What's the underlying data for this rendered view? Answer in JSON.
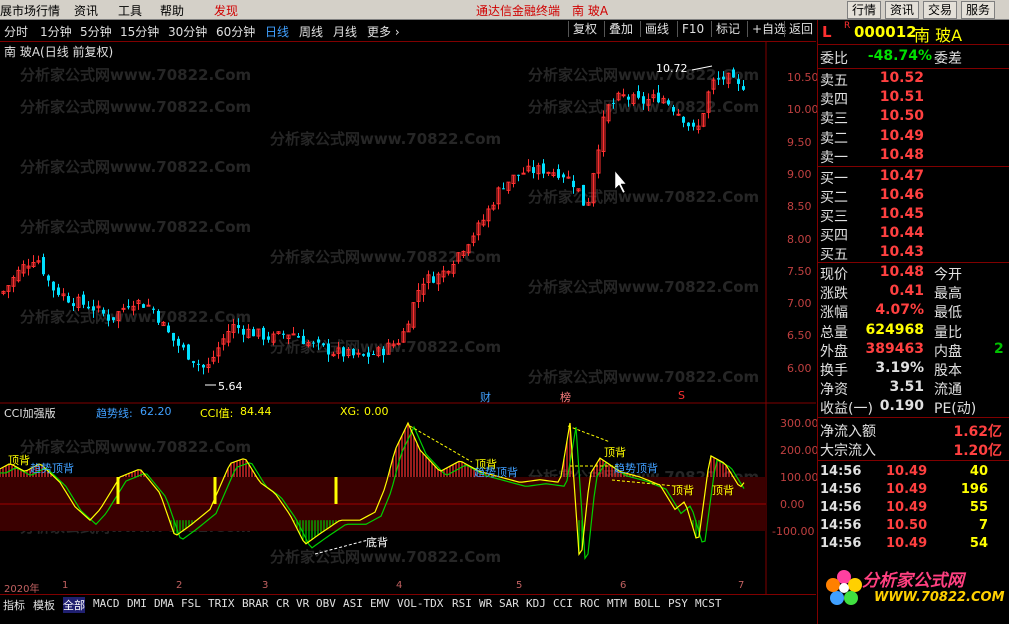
{
  "menu": {
    "items": [
      "展市场行情",
      "资讯",
      "工具",
      "帮助",
      "发现"
    ],
    "center_title": "通达信金融终端",
    "stock_title": "南 玻A",
    "right_buttons": [
      "行情",
      "资讯",
      "交易",
      "服务"
    ]
  },
  "timeframes": [
    "分时",
    "1分钟",
    "5分钟",
    "15分钟",
    "30分钟",
    "60分钟",
    "日线",
    "周线",
    "月线",
    "更多 ›"
  ],
  "active_timeframe": "日线",
  "toolbar_buttons": [
    "复权",
    "叠加",
    "画线",
    "F10",
    "标记",
    "+自选",
    "返回"
  ],
  "chart_title": "南 玻A(日线 前复权)",
  "watermark": "分析家公式网www.70822.Com",
  "price_axis": [
    "10.50",
    "10.00",
    "9.50",
    "9.00",
    "8.50",
    "8.00",
    "7.50",
    "7.00",
    "6.50",
    "6.00"
  ],
  "annotations": {
    "high": "10.72",
    "low": "5.64",
    "cai": "财",
    "mark": "榜",
    "s": "S"
  },
  "indicator": {
    "name": "CCI加强版",
    "trend_label": "趋势线:",
    "trend_value": "62.20",
    "cci_label": "CCI值:",
    "cci_value": "84.44",
    "xg_label": "XG:",
    "xg_value": "0.00",
    "axis": [
      "300.00",
      "200.00",
      "100.00",
      "0.00",
      "-100.00"
    ],
    "labels": [
      "顶背",
      "趋势顶背",
      "顶背",
      "趋势顶背",
      "顶背",
      "趋势顶背",
      "顶背",
      "顶背",
      "底背"
    ]
  },
  "date_axis": {
    "year": "2020年",
    "months": [
      "1",
      "2",
      "3",
      "4",
      "5",
      "6",
      "7"
    ]
  },
  "bottom_tabs": [
    "指标",
    "模板",
    "全部",
    "MACD",
    "DMI",
    "DMA",
    "FSL",
    "TRIX",
    "BRAR",
    "CR",
    "VR",
    "OBV",
    "ASI",
    "EMV",
    "VOL-TDX",
    "RSI",
    "WR",
    "SAR",
    "KDJ",
    "CCI",
    "ROC",
    "MTM",
    "BOLL",
    "PSY",
    "MCST"
  ],
  "active_bottom_tab": "全部",
  "quote": {
    "code": "000012",
    "name": "南 玻A",
    "weibi_label": "委比",
    "weibi": "-48.74%",
    "weicha_label": "委差",
    "asks": [
      {
        "label": "卖五",
        "price": "10.52"
      },
      {
        "label": "卖四",
        "price": "10.51"
      },
      {
        "label": "卖三",
        "price": "10.50"
      },
      {
        "label": "卖二",
        "price": "10.49"
      },
      {
        "label": "卖一",
        "price": "10.48"
      }
    ],
    "bids": [
      {
        "label": "买一",
        "price": "10.47"
      },
      {
        "label": "买二",
        "price": "10.46"
      },
      {
        "label": "买三",
        "price": "10.45"
      },
      {
        "label": "买四",
        "price": "10.44"
      },
      {
        "label": "买五",
        "price": "10.43"
      }
    ],
    "stats": [
      {
        "k": "现价",
        "v": "10.48",
        "k2": "今开",
        "color": "#ff4040"
      },
      {
        "k": "涨跌",
        "v": "0.41",
        "k2": "最高",
        "color": "#ff4040"
      },
      {
        "k": "涨幅",
        "v": "4.07%",
        "k2": "最低",
        "color": "#ff4040"
      },
      {
        "k": "总量",
        "v": "624968",
        "k2": "量比",
        "color": "#ffff00"
      },
      {
        "k": "外盘",
        "v": "389463",
        "k2": "内盘",
        "color": "#ff4040"
      },
      {
        "k": "换手",
        "v": "3.19%",
        "k2": "股本",
        "color": "#e0e0e0"
      },
      {
        "k": "净资",
        "v": "3.51",
        "k2": "流通",
        "color": "#e0e0e0"
      },
      {
        "k": "收益(一)",
        "v": "0.190",
        "k2": "PE(动)",
        "color": "#e0e0e0"
      }
    ],
    "inner_vol_fragment": "2",
    "netflow": [
      {
        "k": "净流入额",
        "v": "1.62亿"
      },
      {
        "k": "大宗流入",
        "v": "1.20亿"
      }
    ],
    "ticks": [
      {
        "time": "14:56",
        "price": "10.49",
        "vol": "40"
      },
      {
        "time": "14:56",
        "price": "10.49",
        "vol": "196"
      },
      {
        "time": "14:56",
        "price": "10.49",
        "vol": "55"
      },
      {
        "time": "14:56",
        "price": "10.50",
        "vol": "7"
      },
      {
        "time": "14:56",
        "price": "10.49",
        "vol": "54"
      }
    ],
    "logo_text": "分析家公式网",
    "logo_url": "WWW.70822.COM"
  },
  "colors": {
    "up": "#ff3030",
    "down": "#00e0ff",
    "panel_border": "#800000"
  }
}
